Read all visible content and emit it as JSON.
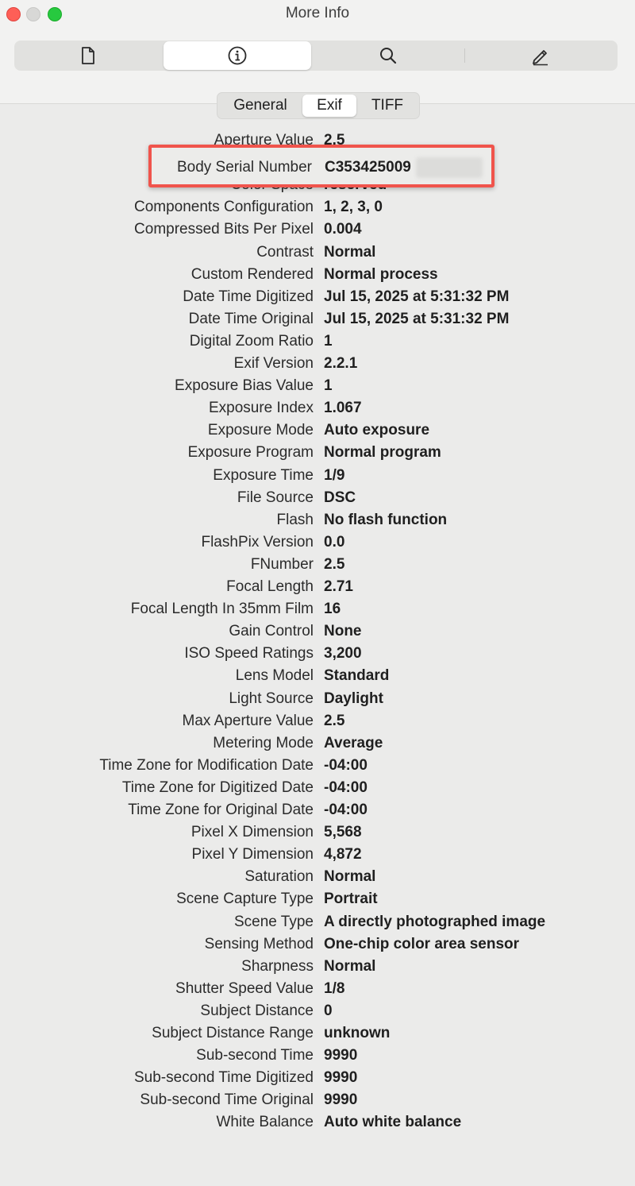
{
  "window": {
    "title": "More Info"
  },
  "toolbar": {
    "buttons": [
      {
        "icon": "document-icon"
      },
      {
        "icon": "info-icon"
      },
      {
        "icon": "search-icon"
      },
      {
        "icon": "pencil-icon"
      }
    ]
  },
  "tabs": [
    {
      "label": "General"
    },
    {
      "label": "Exif"
    },
    {
      "label": "TIFF"
    }
  ],
  "highlighted": {
    "label": "Body Serial Number",
    "value": "C353425009"
  },
  "rows": [
    {
      "label": "Aperture Value",
      "value": "2.5"
    },
    {
      "label": "Color Space",
      "value": "reserved"
    },
    {
      "label": "Components Configuration",
      "value": "1, 2, 3, 0"
    },
    {
      "label": "Compressed Bits Per Pixel",
      "value": "0.004"
    },
    {
      "label": "Contrast",
      "value": "Normal"
    },
    {
      "label": "Custom Rendered",
      "value": "Normal process"
    },
    {
      "label": "Date Time Digitized",
      "value": "Jul 15, 2025 at 5:31:32 PM"
    },
    {
      "label": "Date Time Original",
      "value": "Jul 15, 2025 at 5:31:32 PM"
    },
    {
      "label": "Digital Zoom Ratio",
      "value": "1"
    },
    {
      "label": "Exif Version",
      "value": "2.2.1"
    },
    {
      "label": "Exposure Bias Value",
      "value": "1"
    },
    {
      "label": "Exposure Index",
      "value": "1.067"
    },
    {
      "label": "Exposure Mode",
      "value": "Auto exposure"
    },
    {
      "label": "Exposure Program",
      "value": "Normal program"
    },
    {
      "label": "Exposure Time",
      "value": "1/9"
    },
    {
      "label": "File Source",
      "value": "DSC"
    },
    {
      "label": "Flash",
      "value": "No flash function"
    },
    {
      "label": "FlashPix Version",
      "value": "0.0"
    },
    {
      "label": "FNumber",
      "value": "2.5"
    },
    {
      "label": "Focal Length",
      "value": "2.71"
    },
    {
      "label": "Focal Length In 35mm Film",
      "value": "16"
    },
    {
      "label": "Gain Control",
      "value": "None"
    },
    {
      "label": "ISO Speed Ratings",
      "value": "3,200"
    },
    {
      "label": "Lens Model",
      "value": "Standard"
    },
    {
      "label": "Light Source",
      "value": "Daylight"
    },
    {
      "label": "Max Aperture Value",
      "value": "2.5"
    },
    {
      "label": "Metering Mode",
      "value": "Average"
    },
    {
      "label": "Time Zone for Modification Date",
      "value": "-04:00"
    },
    {
      "label": "Time Zone for Digitized Date",
      "value": "-04:00"
    },
    {
      "label": "Time Zone for Original Date",
      "value": "-04:00"
    },
    {
      "label": "Pixel X Dimension",
      "value": "5,568"
    },
    {
      "label": "Pixel Y Dimension",
      "value": "4,872"
    },
    {
      "label": "Saturation",
      "value": "Normal"
    },
    {
      "label": "Scene Capture Type",
      "value": "Portrait"
    },
    {
      "label": "Scene Type",
      "value": "A directly photographed image"
    },
    {
      "label": "Sensing Method",
      "value": "One-chip color area sensor"
    },
    {
      "label": "Sharpness",
      "value": "Normal"
    },
    {
      "label": "Shutter Speed Value",
      "value": "1/8"
    },
    {
      "label": "Subject Distance",
      "value": "0"
    },
    {
      "label": "Subject Distance Range",
      "value": "unknown"
    },
    {
      "label": "Sub-second Time",
      "value": "9990"
    },
    {
      "label": "Sub-second Time Digitized",
      "value": "9990"
    },
    {
      "label": "Sub-second Time Original",
      "value": "9990"
    },
    {
      "label": "White Balance",
      "value": "Auto white balance"
    }
  ]
}
